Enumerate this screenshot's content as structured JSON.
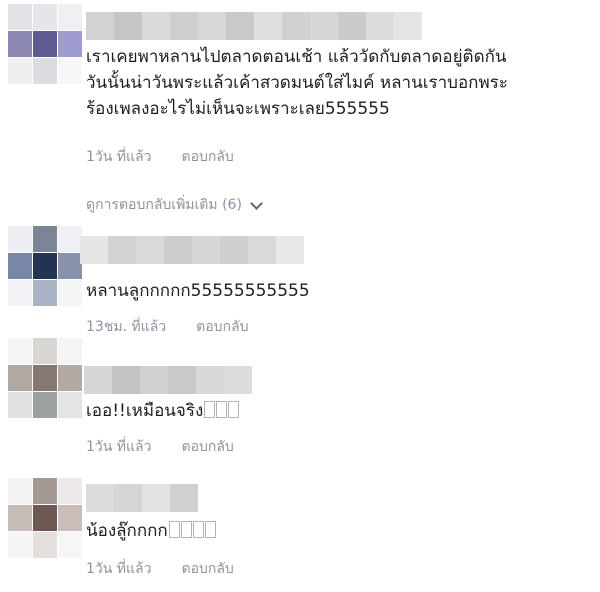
{
  "comments": [
    {
      "lines": [
        "เราเคยพาหลานไปตลาดตอนเช้า แล้ววัดกับตลาดอยู่ติดกัน",
        "วันนั้นน่าวันพระแล้วเค้าสวดมนต์ใส่ไมค์ หลานเราบอกพระ",
        "ร้องเพลงอะไรไม่เห็นจะเพราะเลย555555"
      ],
      "time": "1วัน ที่แล้ว",
      "reply": "ตอบกลับ"
    },
    {
      "lines": [
        "หลานลูกกกกก55555555555"
      ],
      "time": "13ชม. ที่แล้ว",
      "reply": "ตอบกลับ"
    },
    {
      "lines": [
        "เออ!!เหมือนจริง"
      ],
      "time": "1วัน ที่แล้ว",
      "reply": "ตอบกลับ"
    },
    {
      "lines": [
        "น้องลู๊กกกก"
      ],
      "time": "1วัน ที่แล้ว",
      "reply": "ตอบกลับ"
    }
  ],
  "more_replies": {
    "label": "ดูการตอบกลับเพิ่มเติม (6)"
  },
  "colors": {
    "text": "#1c1e21",
    "meta": "#8d949e"
  }
}
